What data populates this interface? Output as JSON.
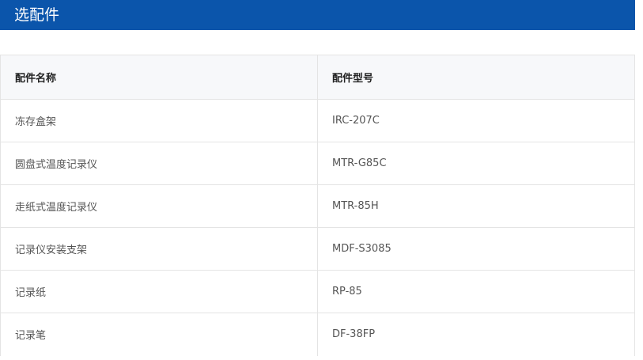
{
  "header": {
    "title": "选配件"
  },
  "table": {
    "columns": [
      "配件名称",
      "配件型号"
    ],
    "rows": [
      {
        "name": "冻存盒架",
        "model": "IRC-207C"
      },
      {
        "name": "圆盘式温度记录仪",
        "model": "MTR-G85C"
      },
      {
        "name": "走纸式温度记录仪",
        "model": "MTR-85H"
      },
      {
        "name": "记录仪安装支架",
        "model": "MDF-S3085"
      },
      {
        "name": "记录纸",
        "model": "RP-85"
      },
      {
        "name": "记录笔",
        "model": "DF-38FP"
      }
    ]
  },
  "colors": {
    "header_bg": "#0b55ab",
    "header_text": "#ffffff",
    "table_header_bg": "#f7f8fa",
    "border": "#e4e4e4"
  }
}
